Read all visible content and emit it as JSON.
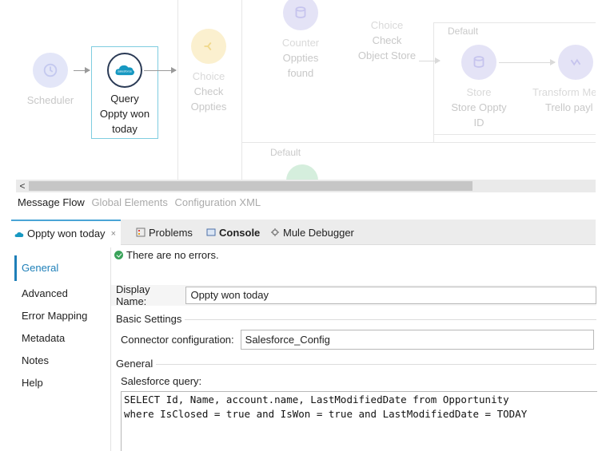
{
  "canvas": {
    "nodes": {
      "scheduler": "Scheduler",
      "query": {
        "type": "Query",
        "name_line1": "Oppty won",
        "name_line2": "today"
      },
      "choice1": {
        "type": "Choice",
        "line1": "Check",
        "line2": "Oppties"
      },
      "counter": {
        "type": "Counter",
        "line1": "Oppties",
        "line2": "found"
      },
      "choice2": {
        "type": "Choice",
        "line1": "Check",
        "line2": "Object Store"
      },
      "store": {
        "type": "Store",
        "line1": "Store Oppty",
        "line2": "ID"
      },
      "transform": {
        "type": "Transform Me",
        "line1": "Trello payl"
      }
    },
    "group_labels": {
      "default_top": "Default",
      "default_bottom": "Default"
    }
  },
  "editor_tabs": [
    "Message Flow",
    "Global Elements",
    "Configuration XML"
  ],
  "panel_tabs": {
    "active": "Oppty won today",
    "close": "×",
    "problems": "Problems",
    "console": "Console",
    "debugger": "Mule Debugger"
  },
  "sidenav": [
    "General",
    "Advanced",
    "Error Mapping",
    "Metadata",
    "Notes",
    "Help"
  ],
  "content": {
    "status": "There are no errors.",
    "display_name_label": "Display Name:",
    "display_name_value": "Oppty won today",
    "basic_settings_title": "Basic Settings",
    "connector_label": "Connector configuration:",
    "connector_value": "Salesforce_Config",
    "general_title": "General",
    "query_label": "Salesforce query:",
    "query_line1": "SELECT Id, Name, account.name, LastModifiedDate from Opportunity",
    "query_line2": "where IsClosed = true and IsWon = true and LastModifiedDate = TODAY"
  },
  "colors": {
    "accent": "#1e7fb8",
    "selected_border": "#7fcde0",
    "tab_accent": "#4aa5d6",
    "ok": "#3aa35a"
  },
  "icons": [
    "clock-icon",
    "salesforce-cloud-icon",
    "choice-icon",
    "database-icon",
    "transform-icon",
    "problems-icon",
    "console-icon",
    "debugger-icon",
    "check-icon"
  ]
}
